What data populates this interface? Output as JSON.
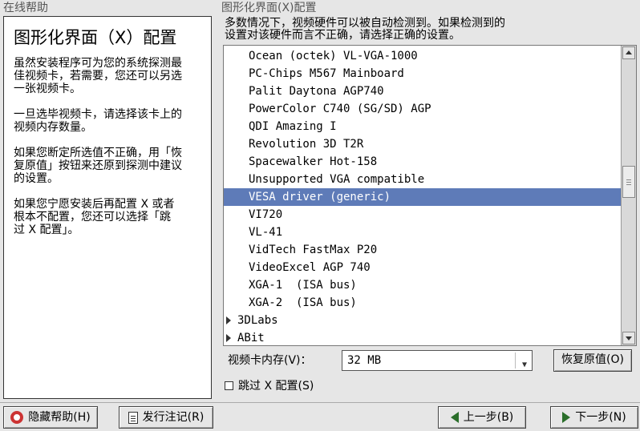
{
  "help": {
    "group_title": "在线帮助",
    "title": "图形化界面（X）配置",
    "paragraphs": [
      "虽然安装程序可为您的系统探测最\n佳视频卡，若需要，您还可以另选\n一张视频卡。",
      "一旦选毕视频卡，请选择该卡上的\n视频内存数量。",
      "如果您断定所选值不正确，用「恢\n复原值」按钮来还原到探测中建议\n的设置。",
      "如果您宁愿安装后再配置 X 或者\n根本不配置，您还可以选择「跳\n过 X 配置」。"
    ]
  },
  "config": {
    "group_title": "图形化界面(X)配置",
    "intro": "多数情况下，视频硬件可以被自动检测到。如果检测到的\n设置对该硬件而言不正确，请选择正确的设置。"
  },
  "card_list": {
    "children": [
      "Ocean (octek) VL-VGA-1000",
      "PC-Chips M567 Mainboard",
      "Palit Daytona AGP740",
      "PowerColor C740 (SG/SD) AGP",
      "QDI Amazing I",
      "Revolution 3D T2R",
      "Spacewalker Hot-158",
      "Unsupported VGA compatible",
      "VESA driver (generic)",
      "VI720",
      "VL-41",
      "VidTech FastMax P20",
      "VideoExcel AGP 740",
      "XGA-1  (ISA bus)",
      "XGA-2  (ISA bus)"
    ],
    "selected": "VESA driver (generic)",
    "groups": [
      "3DLabs",
      "ABit"
    ],
    "selection_color": "#5e7bb8"
  },
  "memory": {
    "label": "视频卡内存(V)：",
    "value": "32 MB"
  },
  "buttons": {
    "restore": "恢复原值(O)",
    "skip_x": "跳过 X 配置(S)",
    "hide_help": "隐藏帮助(H)",
    "release_notes": "发行注记(R)",
    "back": "上一步(B)",
    "next": "下一步(N)"
  }
}
